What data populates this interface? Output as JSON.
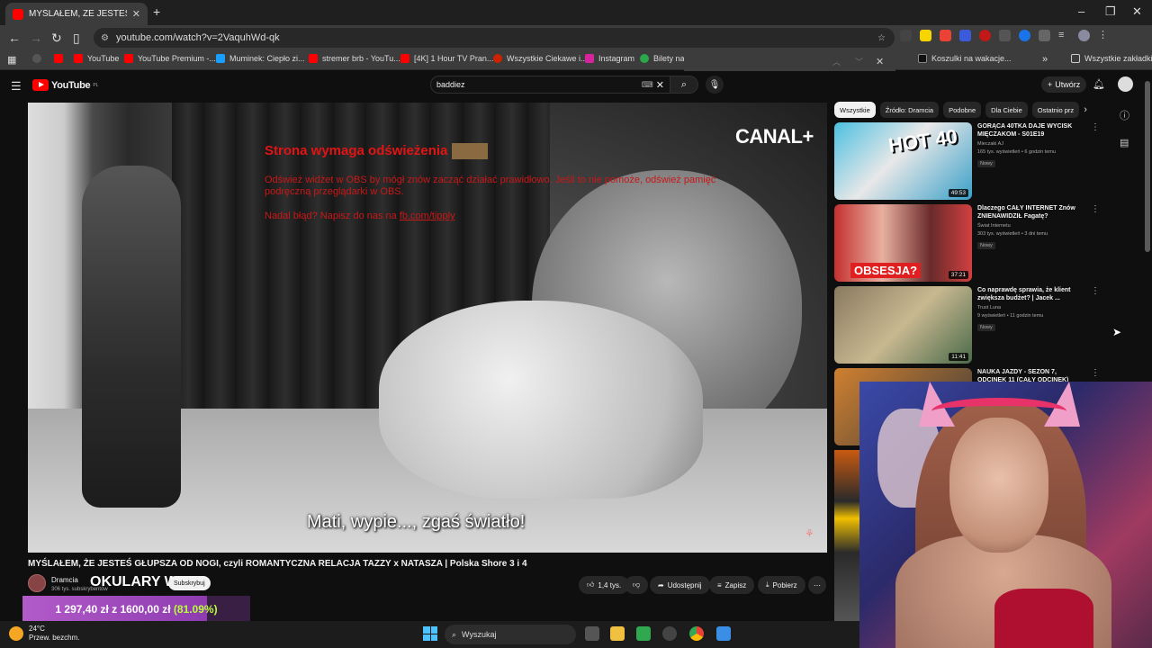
{
  "browser": {
    "tab_title": "MYŚLAŁEM, ŻE JESTEŚ GŁU",
    "url": "youtube.com/watch?v=2VaquhWd-qk",
    "bookmarks": [
      {
        "label": "YouTube",
        "color": "#ff0000"
      },
      {
        "label": "YouTube Premium -...",
        "color": "#ff0000"
      },
      {
        "label": "Muminek: Ciepło zi...",
        "color": "#1a9fff"
      },
      {
        "label": "stremer brb - YouTu...",
        "color": "#ff0000"
      },
      {
        "label": "[4K] 1 Hour TV Pran...",
        "color": "#ff0000"
      },
      {
        "label": "Wszystkie Ciekawe i...",
        "color": "#cc2200"
      },
      {
        "label": "Instagram",
        "color": "#d6249f"
      },
      {
        "label": "Bilety na",
        "color": "#2aa84a"
      },
      {
        "label": "Koszulki na wakacje...",
        "color": "#111111"
      }
    ],
    "bookmarks_all": "Wszystkie zakładki"
  },
  "youtube": {
    "logo": "YouTube",
    "country": "PL",
    "search_value": "baddiez",
    "create_label": "Utwórz"
  },
  "video": {
    "brand": "CANAL+",
    "obs_title": "Strona wymaga odświeżenia",
    "obs_body": "Odśwież widżet w OBS by mógł znów zacząć działać prawidłowo. Jeśli to nie pomoże, odśwież pamięć podręczną przeglądarki w OBS.",
    "obs_help_prefix": "Nadal błąd? Napisz do nas na ",
    "obs_help_link": "fb.com/tipply",
    "subtitle": "Mati, wypie..., zgaś światło!"
  },
  "details": {
    "title": "MYŚLAŁEM, ŻE JESTEŚ GŁUPSZA OD NOGI, czyli ROMANTYCZNA RELACJA TAZZY x NATASZA | Polska Shore 3 i 4",
    "channel": "Dramcia",
    "subscribers": "306 tys. subskrybentów",
    "overlay": "OKULARY W",
    "subscribe": "Subskrybuj",
    "likes": "1,4 tys.",
    "share": "Udostępnij",
    "save": "Zapisz",
    "download": "Pobierz"
  },
  "goal": {
    "current": "1 297,40 zł",
    "sep": "z",
    "target": "1600,00 zł",
    "percent": "(81.09%)",
    "progress": 0.8109
  },
  "chips": [
    "Wszystkie",
    "Źródło: Dramcia",
    "Podobne",
    "Dla Ciebie",
    "Ostatnio prz"
  ],
  "recommendations": [
    {
      "title": "GORĄCA 40TKA DAJE WYCISK MIĘCZAKOM - S01E19",
      "channel": "Mieczaki AJ",
      "meta": "165 tys. wyświetleń • 6 godzin temu",
      "badge": "Nowy",
      "duration": "49:53",
      "thumb_text": "HOT 40"
    },
    {
      "title": "Dlaczego CAŁY INTERNET Znów ZNIENAWIDZIŁ Fagatę?",
      "channel": "Świat Internetu",
      "meta": "303 tys. wyświetleń • 3 dni temu",
      "badge": "Nowy",
      "duration": "37:21",
      "thumb_text": "OBSESJA?"
    },
    {
      "title": "Co naprawdę sprawia, że klient zwiększa budżet? | Jacek ...",
      "channel": "Trust Luna",
      "meta": "9 wyświetleń • 11 godzin temu",
      "badge": "Nowy",
      "duration": "11:41",
      "thumb_text": ""
    },
    {
      "title": "NAUKA JAZDY - SEZON 7, ODCINEK 11 (CAŁY ODCINEK)",
      "channel": "",
      "meta": "",
      "badge": "",
      "duration": "",
      "thumb_text": ""
    }
  ],
  "taskbar": {
    "temp": "24°C",
    "condition": "Przew. bezchm.",
    "search": "Wyszukaj"
  }
}
